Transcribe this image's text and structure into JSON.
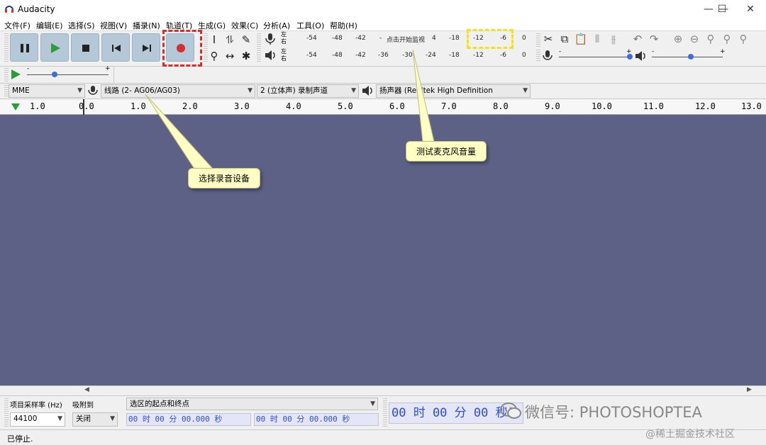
{
  "window": {
    "title": "Audacity"
  },
  "menu": [
    "文件(F)",
    "编辑(E)",
    "选择(S)",
    "视图(V)",
    "播录(N)",
    "轨道(T)",
    "生成(G)",
    "效果(C)",
    "分析(A)",
    "工具(O)",
    "帮助(H)"
  ],
  "meters": {
    "record_lr": [
      "左",
      "右"
    ],
    "play_lr": [
      "左",
      "右"
    ],
    "record_scale": [
      "-54",
      "-48",
      "-42",
      "-",
      "4",
      "-18",
      "-12",
      "-6",
      "0"
    ],
    "record_prompt": "点击开始监视",
    "play_scale": [
      "-54",
      "-48",
      "-42",
      "-36",
      "-30",
      "-24",
      "-18",
      "-12",
      "-6",
      "0"
    ]
  },
  "sliders": {
    "minus": "-",
    "plus": "+"
  },
  "device": {
    "host": "MME",
    "input": "线路 (2- AG06/AG03)",
    "channels": "2 (立体声) 录制声道",
    "output": "扬声器 (Realtek High Definition"
  },
  "ruler": [
    "1.0",
    "0.0",
    "1.0",
    "2.0",
    "3.0",
    "4.0",
    "5.0",
    "6.0",
    "7.0",
    "8.0",
    "9.0",
    "10.0",
    "11.0",
    "12.0",
    "13.0"
  ],
  "callouts": {
    "select_device": "选择录音设备",
    "test_mic": "测试麦克风音量"
  },
  "selection": {
    "rate_label": "项目采样率 (Hz)",
    "snap_label": "吸附到",
    "rate_value": "44100",
    "snap_value": "关闭",
    "range_label": "选区的起点和终点",
    "time_start": "00 时 00 分 00.000 秒",
    "time_end": "00 时 00 分 00.000 秒",
    "audio_pos": "00 时 00 分 00 秒"
  },
  "status": "已停止.",
  "watermark": {
    "wechat": "微信号: PHOTOSHOPTEA",
    "site": "@稀土掘金技术社区"
  },
  "colors": {
    "track_bg": "#5c6185",
    "accent_red": "#d32f2f",
    "play_green": "#2e9b3a",
    "callout_bg": "#ffffc4",
    "highlight_yellow": "#f1e21d"
  }
}
